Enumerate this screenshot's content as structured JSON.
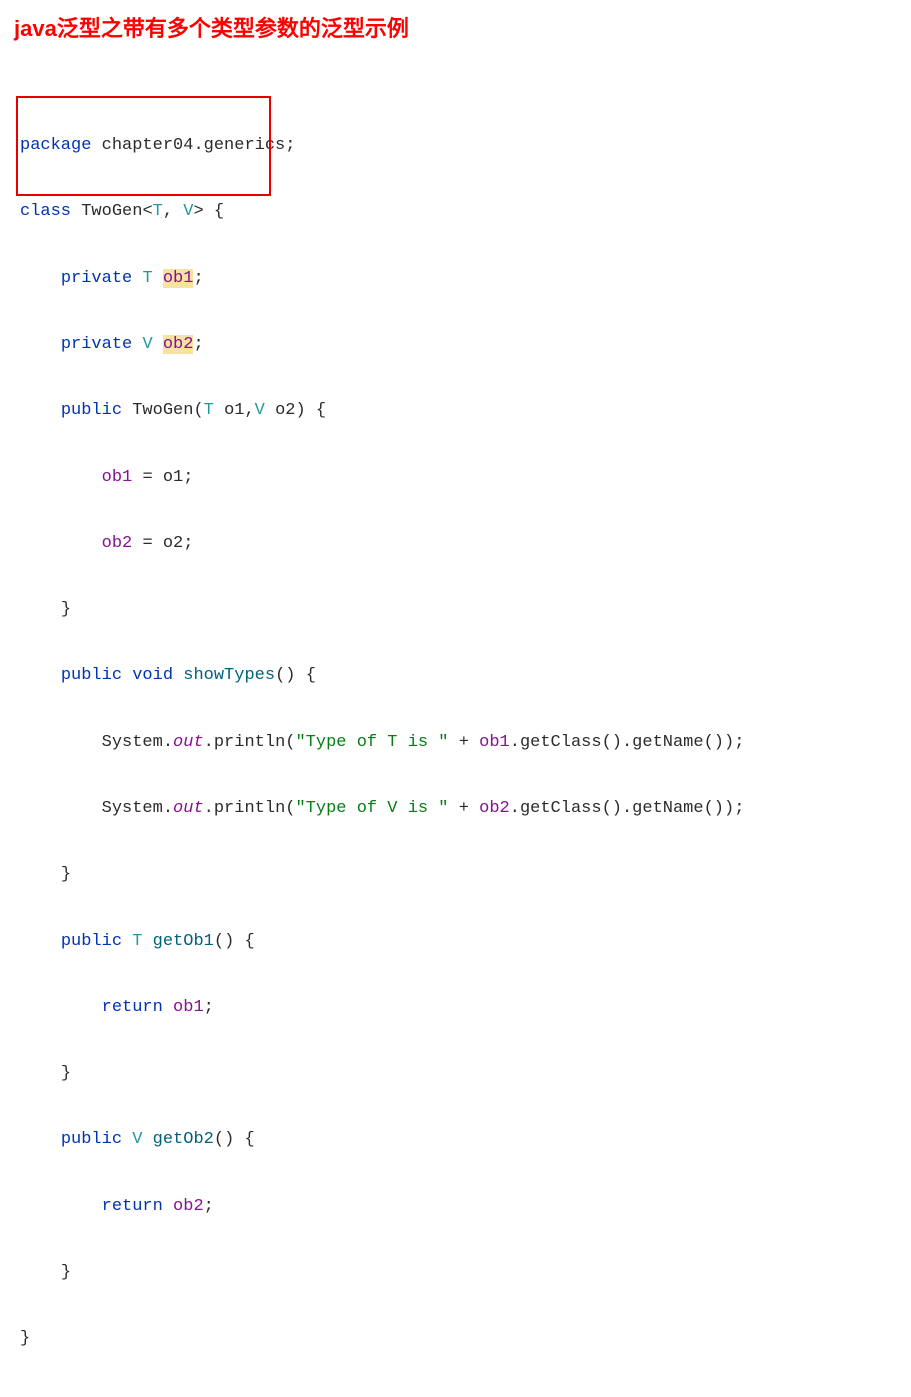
{
  "title": "java泛型之带有多个类型参数的泛型示例",
  "code": {
    "kw_package": "package",
    "pkg_name": "chapter04.generics",
    "kw_class": "class",
    "class_name": "TwoGen",
    "type_T": "T",
    "type_V": "V",
    "kw_private": "private",
    "field_ob1": "ob1",
    "field_ob2": "ob2",
    "kw_public": "public",
    "ctor_name": "TwoGen",
    "param_o1": "o1",
    "param_o2": "o2",
    "assign_ob1": "ob1",
    "assign_o1": "o1",
    "assign_ob2": "ob2",
    "assign_o2": "o2",
    "kw_void": "void",
    "method_showTypes": "showTypes",
    "sys": "System",
    "out": "out",
    "println": "println",
    "str_T": "\"Type of T is \"",
    "str_V": "\"Type of V is \"",
    "use_ob1": "ob1",
    "use_ob2": "ob2",
    "getClass": "getClass",
    "getName": "getName",
    "method_getOb1": "getOb1",
    "method_getOb2": "getOb2",
    "kw_return": "return",
    "ret_ob1": "ob1",
    "ret_ob2": "ob2",
    "semicolon": ";",
    "lbrace": "{",
    "rbrace": "}",
    "lparen": "(",
    "rparen": ")",
    "lt": "<",
    "gt": ">",
    "comma": ",",
    "dot": ".",
    "eq": "=",
    "plus": "+",
    "space": " "
  }
}
